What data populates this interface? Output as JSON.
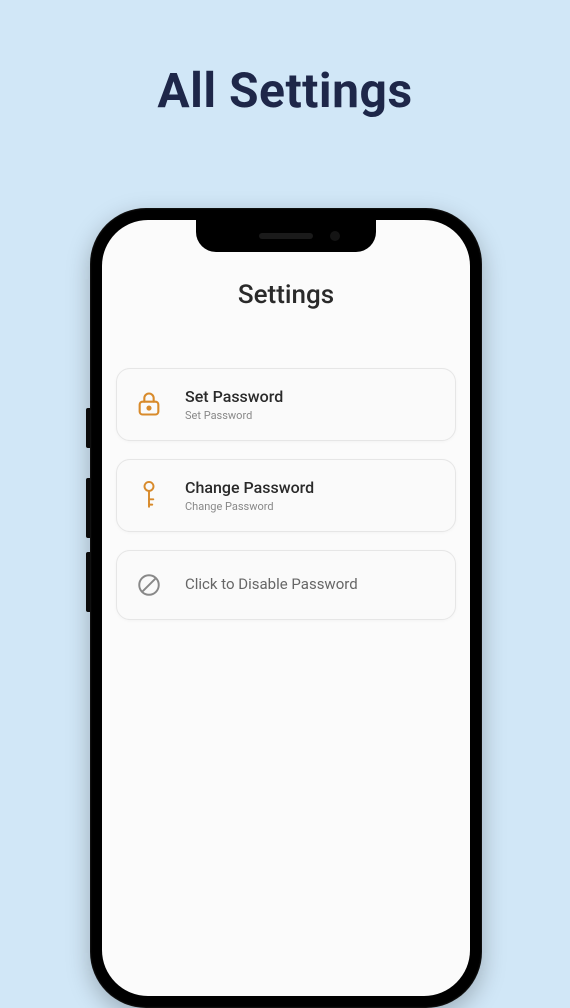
{
  "page": {
    "title": "All Settings"
  },
  "app": {
    "title": "Settings"
  },
  "settings": [
    {
      "title": "Set Password",
      "subtitle": "Set Password",
      "icon": "lock"
    },
    {
      "title": "Change Password",
      "subtitle": "Change Password",
      "icon": "key"
    },
    {
      "title": "Click to Disable Password",
      "subtitle": "",
      "icon": "disable"
    }
  ],
  "colors": {
    "accent": "#d88a2a",
    "background": "#d1e7f7"
  }
}
